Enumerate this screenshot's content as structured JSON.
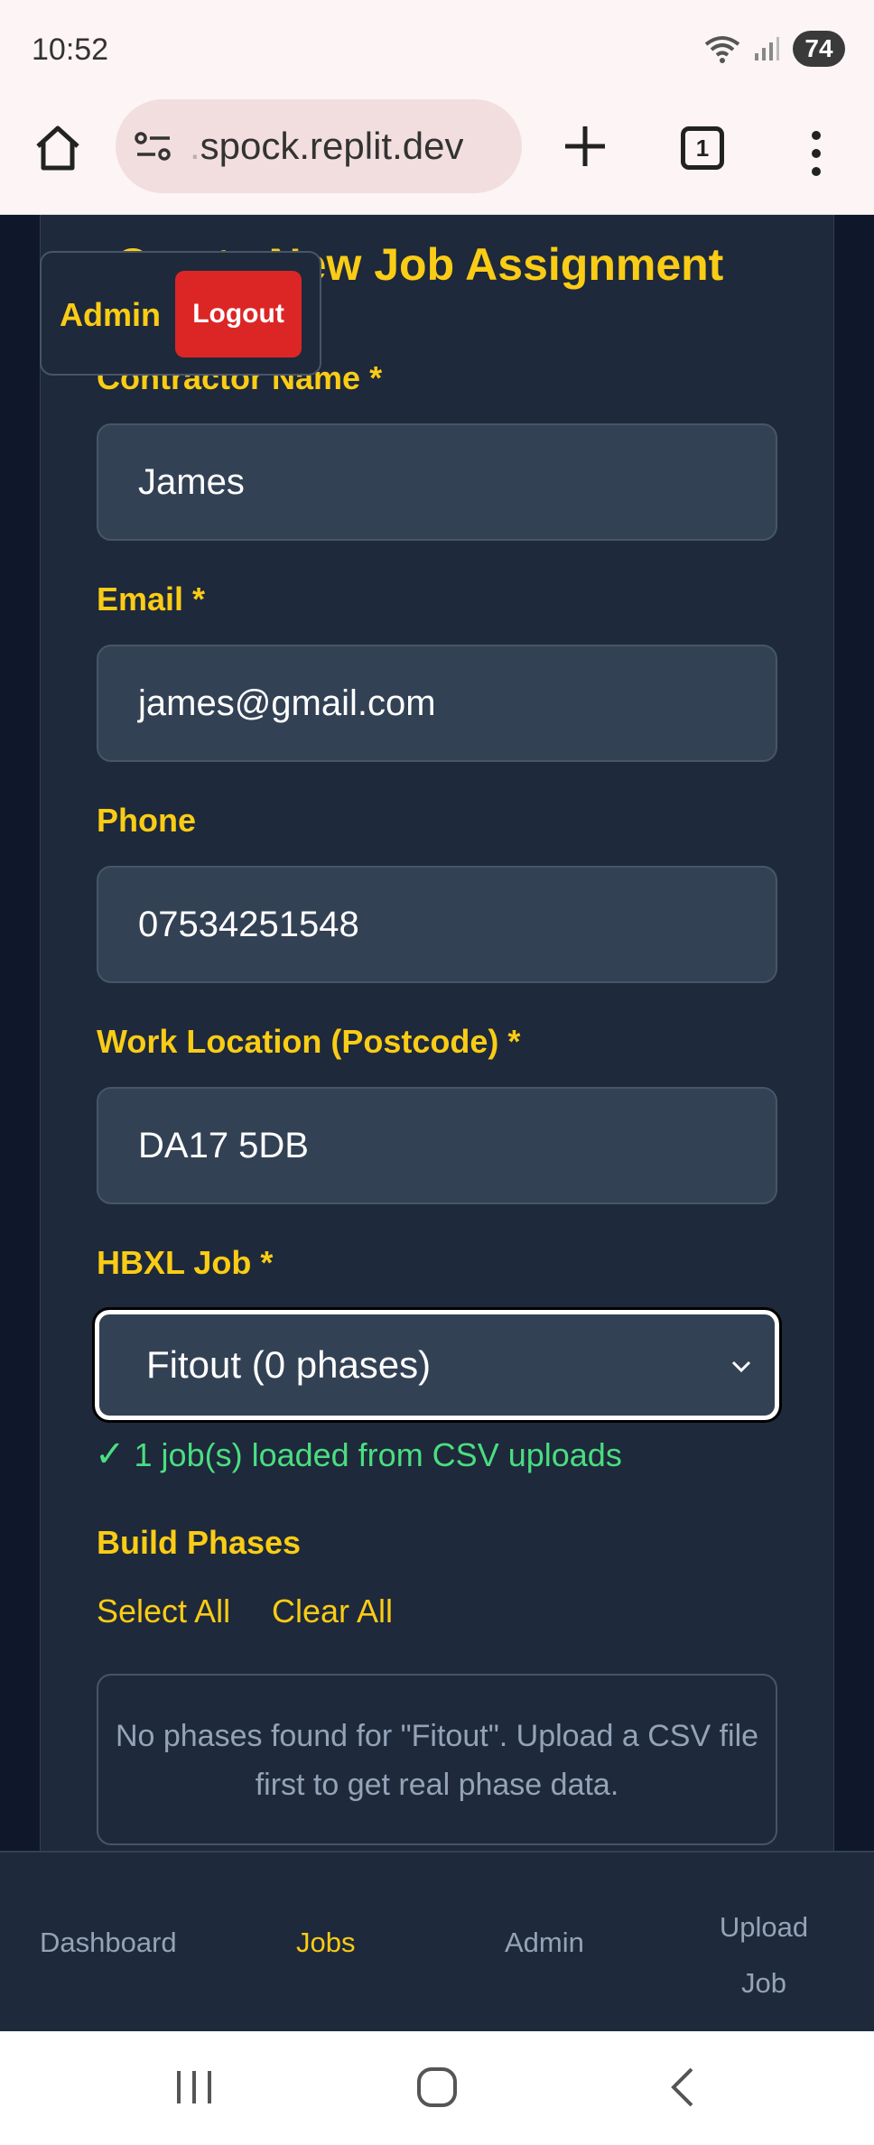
{
  "status_bar": {
    "time": "10:52",
    "battery": "74"
  },
  "browser": {
    "url_prefix": ".",
    "url": "spock.replit.dev",
    "tab_count": "1"
  },
  "page": {
    "title": "Create New Job Assignment"
  },
  "admin_bar": {
    "label": "Admin",
    "logout_label": "Logout"
  },
  "form": {
    "contractor_name": {
      "label": "Contractor Name *",
      "value": "James"
    },
    "email": {
      "label": "Email *",
      "value": "james@gmail.com"
    },
    "phone": {
      "label": "Phone",
      "value": "07534251548"
    },
    "work_location": {
      "label": "Work Location (Postcode) *",
      "value": "DA17 5DB"
    },
    "hbxl_job": {
      "label": "HBXL Job *",
      "selected": "Fitout (0 phases)"
    },
    "csv_status": {
      "check": "✓",
      "text": "1 job(s) loaded from CSV uploads"
    },
    "build_phases": {
      "label": "Build Phases",
      "select_all": "Select All",
      "clear_all": "Clear All",
      "empty_message": "No phases found for \"Fitout\". Upload a CSV file first to get real phase data."
    }
  },
  "bottom_nav": {
    "items": [
      {
        "label": "Dashboard",
        "active": false
      },
      {
        "label": "Jobs",
        "active": true
      },
      {
        "label": "Admin",
        "active": false
      },
      {
        "label": "Upload Job",
        "active": false
      }
    ]
  },
  "icons": [
    "home-icon",
    "site-settings-icon",
    "plus-icon",
    "tabs-icon",
    "more-vert-icon",
    "wifi-icon",
    "signal-icon",
    "chevron-down-icon",
    "recents-icon",
    "home-circle-icon",
    "back-icon"
  ],
  "colors": {
    "accent": "#facc15",
    "danger": "#dc2626",
    "success": "#4ade80",
    "panel": "#1e293b",
    "input": "#334155"
  }
}
